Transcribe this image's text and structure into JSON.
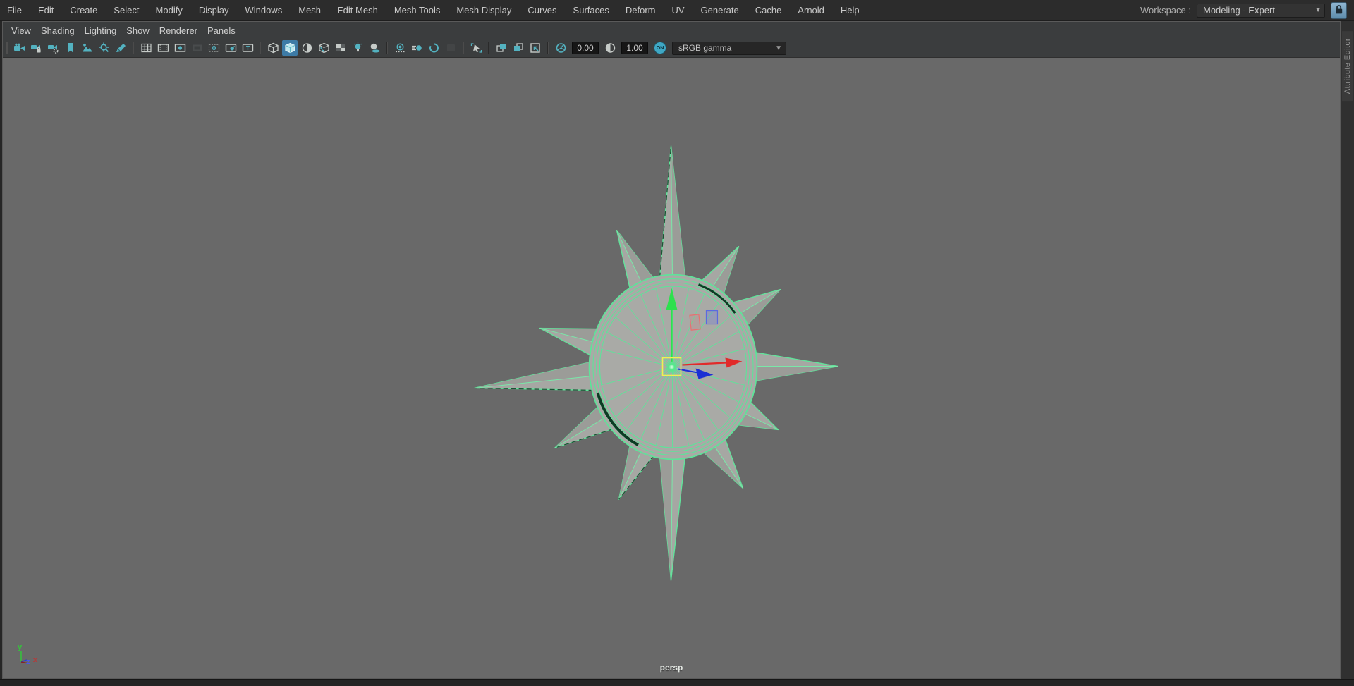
{
  "menu_bar": {
    "items": [
      "File",
      "Edit",
      "Create",
      "Select",
      "Modify",
      "Display",
      "Windows",
      "Mesh",
      "Edit Mesh",
      "Mesh Tools",
      "Mesh Display",
      "Curves",
      "Surfaces",
      "Deform",
      "UV",
      "Generate",
      "Cache",
      "Arnold",
      "Help"
    ],
    "workspace_label": "Workspace :",
    "workspace_value": "Modeling - Expert",
    "lock_icon": "lock-icon"
  },
  "panel_menus": [
    "View",
    "Shading",
    "Lighting",
    "Show",
    "Renderer",
    "Panels"
  ],
  "toolbar": {
    "groups": [
      [
        {
          "name": "select-camera",
          "glyph": "camera"
        },
        {
          "name": "lock-camera",
          "glyph": "camera-lock"
        },
        {
          "name": "camera-attributes",
          "glyph": "camera-attributes"
        },
        {
          "name": "bookmarks",
          "glyph": "bookmark"
        },
        {
          "name": "image-plane",
          "glyph": "image-plane"
        },
        {
          "name": "2d-pan-zoom",
          "glyph": "pan-zoom"
        },
        {
          "name": "grease-pencil",
          "glyph": "grease-pencil"
        }
      ],
      [
        {
          "name": "grid",
          "glyph": "grid"
        },
        {
          "name": "film-gate",
          "glyph": "film-gate"
        },
        {
          "name": "resolution-gate",
          "glyph": "resolution-gate"
        },
        {
          "name": "gate-mask",
          "glyph": "gate-mask",
          "disabled": true
        },
        {
          "name": "field-chart",
          "glyph": "field-chart"
        },
        {
          "name": "safe-action",
          "glyph": "safe-action"
        },
        {
          "name": "safe-title",
          "glyph": "safe-title"
        }
      ],
      [
        {
          "name": "wireframe",
          "glyph": "cube-wire"
        },
        {
          "name": "smooth-shade-all",
          "glyph": "cube-shaded",
          "active": true
        },
        {
          "name": "shade-selected-items",
          "glyph": "material-ball"
        },
        {
          "name": "textured",
          "glyph": "cube-textured"
        },
        {
          "name": "use-default-material",
          "glyph": "checker"
        },
        {
          "name": "lighting",
          "glyph": "bulb"
        },
        {
          "name": "shadows",
          "glyph": "shadows"
        }
      ],
      [
        {
          "name": "screen-space-ao",
          "glyph": "ssao"
        },
        {
          "name": "motion-blur",
          "glyph": "motion-blur"
        },
        {
          "name": "anti-aliasing",
          "glyph": "anti-alias"
        },
        {
          "name": "multisampling",
          "glyph": "blank-disabled",
          "disabled": true
        }
      ],
      [
        {
          "name": "isolate-select",
          "glyph": "isolate-select"
        }
      ],
      [
        {
          "name": "tear-off",
          "glyph": "pane-back"
        },
        {
          "name": "tear-off-copy",
          "glyph": "pane-front"
        },
        {
          "name": "panel-window",
          "glyph": "pane-arrow"
        }
      ]
    ],
    "exposure_value": "0.00",
    "gamma_value": "1.00",
    "on_label": "ON",
    "view_transform": "sRGB gamma"
  },
  "viewport": {
    "camera_label": "persp",
    "axis_x": "x",
    "axis_y": "y",
    "axis_z": "z"
  },
  "right_panel_tab": "Attribute Editor",
  "colors": {
    "viewport_bg": "#696969",
    "wireframe_selected": "#5ee399",
    "manip_x": "#e12a2a",
    "manip_y": "#2ee04e",
    "manip_z": "#1c2fd4",
    "manip_center": "#f0f052",
    "active_tool_bg": "#3d7ba6"
  }
}
